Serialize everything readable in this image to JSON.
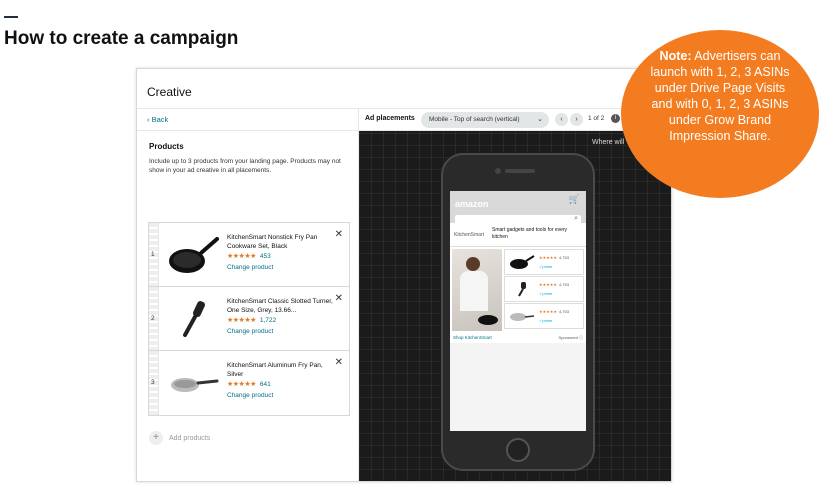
{
  "slide": {
    "title": "How to create a campaign"
  },
  "note": {
    "bold": "Note:",
    "text": " Advertisers can launch with 1, 2, 3 ASINs under Drive Page Visits and with 0, 1, 2, 3 ASINs under Grow Brand Impression Share."
  },
  "creative": {
    "header": "Creative",
    "back_label": "‹ Back",
    "products_title": "Products",
    "products_desc": "Include up to 3 products from your landing page. Products may not show in your ad creative in all placements.",
    "products": [
      {
        "index": "1",
        "name": "KitchenSmart Nonstick Fry Pan Cookware Set, Black",
        "stars": "★★★★★",
        "count": "453",
        "change": "Change product",
        "remove": "✕"
      },
      {
        "index": "2",
        "name": "KitchenSmart Classic Slotted Turner, One Size, Grey, 13.66...",
        "stars": "★★★★★",
        "count": "1,722",
        "change": "Change product",
        "remove": "✕"
      },
      {
        "index": "3",
        "name": "KitchenSmart Aluminum Fry Pan, Silver",
        "stars": "★★★★★",
        "count": "641",
        "change": "Change product",
        "remove": "✕"
      }
    ],
    "add_products": "Add products"
  },
  "preview": {
    "placements_label": "Ad placements",
    "placement_value": "Mobile - Top of search (vertical)",
    "prev": "‹",
    "next": "›",
    "page": "1 of 2",
    "info": "i",
    "where": "Where will",
    "phone": {
      "logo": "amazon",
      "brand_logo": "KitchenSmart",
      "headline": "Smart gadgets and tools for every kitchen",
      "tiles": [
        {
          "stars": "★★★★★",
          "count": "4,753",
          "prime": "✓prime"
        },
        {
          "stars": "★★★★★",
          "count": "4,753",
          "prime": "✓prime"
        },
        {
          "stars": "★★★★★",
          "count": "4,753",
          "prime": "✓prime"
        }
      ],
      "shop_link": "Shop KitchenSmart",
      "sponsored": "Sponsored ⓘ"
    }
  }
}
